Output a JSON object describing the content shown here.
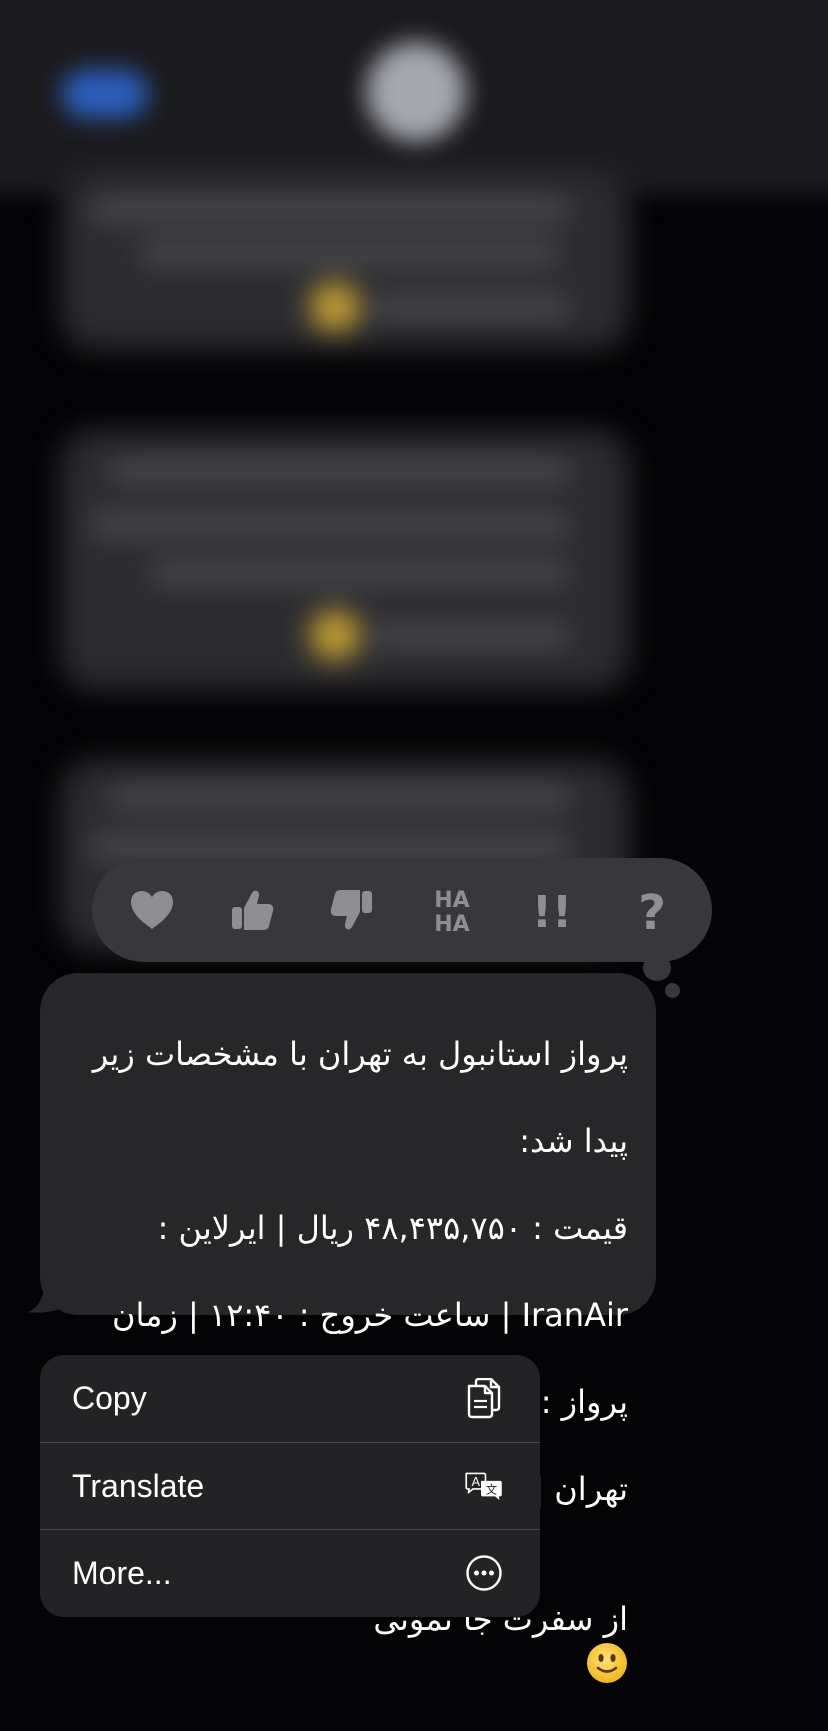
{
  "message": {
    "lines": [
      "پرواز استانبول به تهران با مشخصات زیر",
      "پیدا شد:",
      "قیمت : ۴۸,۴۳۵,۷۵۰ ریال | ایرلاین :",
      "IranAir | ساعت خروج : ۱۲:۴۰ | زمان",
      "پرواز : ۰۳:۰۰ | مبدا : استانبول | مقصد :",
      "تهران |",
      "از سفرت جا نمونی"
    ],
    "emoji": "slightly-smiling-face-icon"
  },
  "reactions": [
    {
      "name": "heart",
      "icon": "heart-icon"
    },
    {
      "name": "thumbs-up",
      "icon": "thumbs-up-icon"
    },
    {
      "name": "thumbs-down",
      "icon": "thumbs-down-icon"
    },
    {
      "name": "haha",
      "icon": "haha-icon",
      "text_top": "HA",
      "text_bottom": "HA"
    },
    {
      "name": "emphasize",
      "icon": "double-exclamation-icon",
      "text": "!!"
    },
    {
      "name": "question",
      "icon": "question-icon",
      "text": "?"
    }
  ],
  "menu": {
    "items": [
      {
        "label": "Copy",
        "icon": "copy-icon"
      },
      {
        "label": "Translate",
        "icon": "translate-icon",
        "icon_text_a": "A",
        "icon_text_b": "文"
      },
      {
        "label": "More...",
        "icon": "more-icon"
      }
    ]
  },
  "colors": {
    "background": "#040406",
    "bubble": "#27272a",
    "reaction_bar": "#38383b",
    "reaction_icon": "#8e8e93",
    "menu": "#232325",
    "separator": "#4a4a4e"
  }
}
